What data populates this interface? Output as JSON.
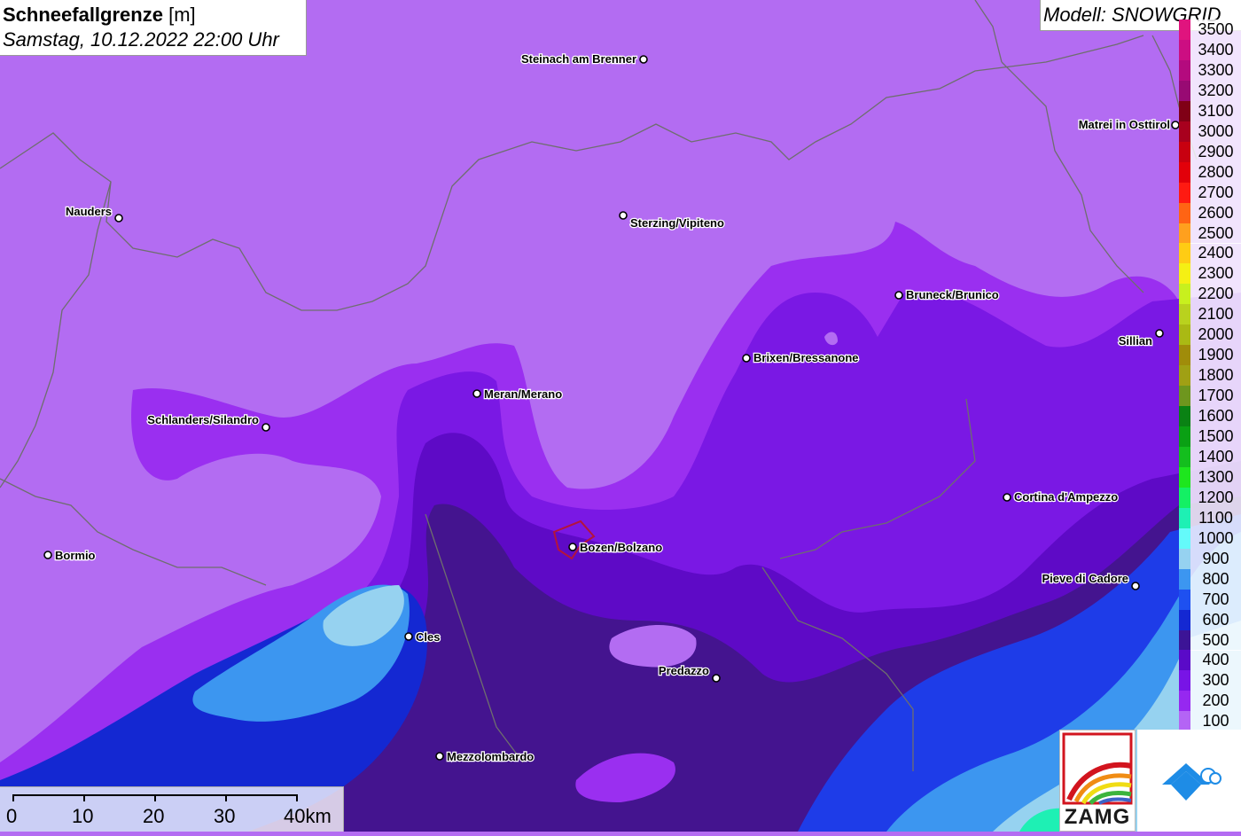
{
  "title": {
    "main": "Schneefallgrenze",
    "unit": "[m]",
    "datetime": "Samstag, 10.12.2022 22:00 Uhr"
  },
  "model": "Modell: SNOWGRID",
  "legend": [
    {
      "label": "3500",
      "color": "#e0147e"
    },
    {
      "label": "3400",
      "color": "#cc0e82"
    },
    {
      "label": "3300",
      "color": "#b40a7e"
    },
    {
      "label": "3200",
      "color": "#980a73"
    },
    {
      "label": "3100",
      "color": "#800016"
    },
    {
      "label": "3000",
      "color": "#a8001e"
    },
    {
      "label": "2900",
      "color": "#c80010"
    },
    {
      "label": "2800",
      "color": "#e2000a"
    },
    {
      "label": "2700",
      "color": "#ff1a12"
    },
    {
      "label": "2600",
      "color": "#ff6414"
    },
    {
      "label": "2500",
      "color": "#ffa01e"
    },
    {
      "label": "2400",
      "color": "#ffcc14"
    },
    {
      "label": "2300",
      "color": "#f5f014"
    },
    {
      "label": "2200",
      "color": "#c8f01e"
    },
    {
      "label": "2100",
      "color": "#b9d21e"
    },
    {
      "label": "2000",
      "color": "#aab914"
    },
    {
      "label": "1900",
      "color": "#a08c0a"
    },
    {
      "label": "1800",
      "color": "#a0a014"
    },
    {
      "label": "1700",
      "color": "#6e961e"
    },
    {
      "label": "1600",
      "color": "#0a8214"
    },
    {
      "label": "1500",
      "color": "#0aa014"
    },
    {
      "label": "1400",
      "color": "#14be1e"
    },
    {
      "label": "1300",
      "color": "#1ee61e"
    },
    {
      "label": "1200",
      "color": "#14f064"
    },
    {
      "label": "1100",
      "color": "#1ef0b4"
    },
    {
      "label": "1000",
      "color": "#64fafa"
    },
    {
      "label": "900",
      "color": "#96d2f0"
    },
    {
      "label": "800",
      "color": "#3c96f0"
    },
    {
      "label": "700",
      "color": "#1e50f0"
    },
    {
      "label": "600",
      "color": "#1428d2"
    },
    {
      "label": "500",
      "color": "#3c1496"
    },
    {
      "label": "400",
      "color": "#5a0ac8"
    },
    {
      "label": "300",
      "color": "#7814e6"
    },
    {
      "label": "200",
      "color": "#9628f0"
    },
    {
      "label": "100",
      "color": "#b464f5"
    }
  ],
  "cities": [
    {
      "name": "Steinach am Brenner"
    },
    {
      "name": "Matrei in Osttirol"
    },
    {
      "name": "Nauders"
    },
    {
      "name": "Sterzing/Vipiteno"
    },
    {
      "name": "Bruneck/Brunico"
    },
    {
      "name": "Sillian"
    },
    {
      "name": "Brixen/Bressanone"
    },
    {
      "name": "Meran/Merano"
    },
    {
      "name": "Schlanders/Silandro"
    },
    {
      "name": "Cortina d'Ampezzo"
    },
    {
      "name": "Bormio"
    },
    {
      "name": "Bozen/Bolzano"
    },
    {
      "name": "Pieve di Cadore"
    },
    {
      "name": "Cles"
    },
    {
      "name": "Predazzo"
    },
    {
      "name": "Mezzolombardo"
    }
  ],
  "scalebar": {
    "ticks": [
      "0",
      "10",
      "20",
      "30",
      "40km"
    ]
  },
  "logo": {
    "text": "ZAMG"
  }
}
